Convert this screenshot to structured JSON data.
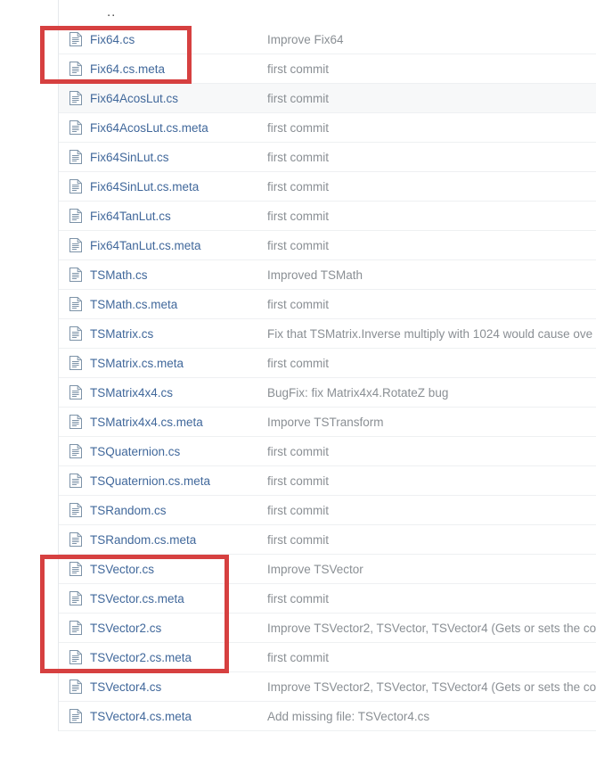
{
  "watermark": {
    "text": ""
  },
  "table": {
    "parent_dir_label": "..",
    "columns": [
      "name",
      "commit_message"
    ],
    "rows": [
      {
        "name": "Fix64.cs",
        "message": "Improve Fix64",
        "icon": "file-icon",
        "shaded": false
      },
      {
        "name": "Fix64.cs.meta",
        "message": "first commit",
        "icon": "file-icon",
        "shaded": false
      },
      {
        "name": "Fix64AcosLut.cs",
        "message": "first commit",
        "icon": "file-icon",
        "shaded": true
      },
      {
        "name": "Fix64AcosLut.cs.meta",
        "message": "first commit",
        "icon": "file-icon",
        "shaded": false
      },
      {
        "name": "Fix64SinLut.cs",
        "message": "first commit",
        "icon": "file-icon",
        "shaded": false
      },
      {
        "name": "Fix64SinLut.cs.meta",
        "message": "first commit",
        "icon": "file-icon",
        "shaded": false
      },
      {
        "name": "Fix64TanLut.cs",
        "message": "first commit",
        "icon": "file-icon",
        "shaded": false
      },
      {
        "name": "Fix64TanLut.cs.meta",
        "message": "first commit",
        "icon": "file-icon",
        "shaded": false
      },
      {
        "name": "TSMath.cs",
        "message": "Improved TSMath",
        "icon": "file-icon",
        "shaded": false
      },
      {
        "name": "TSMath.cs.meta",
        "message": "first commit",
        "icon": "file-icon",
        "shaded": false
      },
      {
        "name": "TSMatrix.cs",
        "message": "Fix that TSMatrix.Inverse multiply with 1024 would cause ove",
        "icon": "file-icon",
        "shaded": false
      },
      {
        "name": "TSMatrix.cs.meta",
        "message": "first commit",
        "icon": "file-icon",
        "shaded": false
      },
      {
        "name": "TSMatrix4x4.cs",
        "message": "BugFix: fix Matrix4x4.RotateZ bug",
        "icon": "file-icon",
        "shaded": false
      },
      {
        "name": "TSMatrix4x4.cs.meta",
        "message": "Imporve TSTransform",
        "icon": "file-icon",
        "shaded": false
      },
      {
        "name": "TSQuaternion.cs",
        "message": "first commit",
        "icon": "file-icon",
        "shaded": false
      },
      {
        "name": "TSQuaternion.cs.meta",
        "message": "first commit",
        "icon": "file-icon",
        "shaded": false
      },
      {
        "name": "TSRandom.cs",
        "message": "first commit",
        "icon": "file-icon",
        "shaded": false
      },
      {
        "name": "TSRandom.cs.meta",
        "message": "first commit",
        "icon": "file-icon",
        "shaded": false
      },
      {
        "name": "TSVector.cs",
        "message": "Improve TSVector",
        "icon": "file-icon",
        "shaded": false
      },
      {
        "name": "TSVector.cs.meta",
        "message": "first commit",
        "icon": "file-icon",
        "shaded": false
      },
      {
        "name": "TSVector2.cs",
        "message": "Improve TSVector2, TSVector, TSVector4 (Gets or sets the co",
        "icon": "file-icon",
        "shaded": false
      },
      {
        "name": "TSVector2.cs.meta",
        "message": "first commit",
        "icon": "file-icon",
        "shaded": false
      },
      {
        "name": "TSVector4.cs",
        "message": "Improve TSVector2, TSVector, TSVector4 (Gets or sets the co",
        "icon": "file-icon",
        "shaded": false
      },
      {
        "name": "TSVector4.cs.meta",
        "message": "Add missing file: TSVector4.cs",
        "icon": "file-icon",
        "shaded": false
      }
    ]
  },
  "annotations": [
    {
      "id": "annot-box-1",
      "color": "#d64040",
      "covers": [
        "Fix64.cs",
        "Fix64.cs.meta"
      ]
    },
    {
      "id": "annot-box-2",
      "color": "#d64040",
      "covers": [
        "TSVector.cs",
        "TSVector.cs.meta",
        "TSVector2.cs",
        "TSVector2.cs.meta"
      ]
    }
  ],
  "colors": {
    "link": "#41689b",
    "message": "#8a8f94",
    "row_border": "#eef0f2",
    "row_shaded": "#f7f8f9",
    "annotation": "#d64040"
  }
}
